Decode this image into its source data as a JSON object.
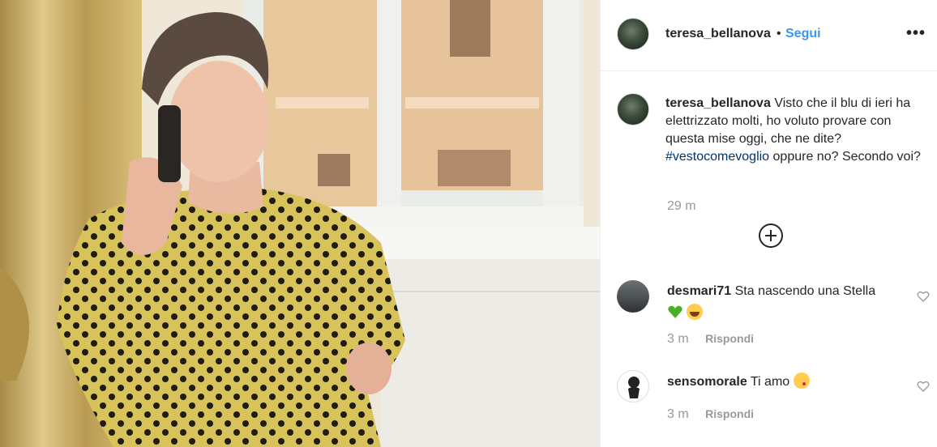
{
  "post": {
    "username": "teresa_bellanova",
    "separator": "•",
    "follow_label": "Segui",
    "more_label": "•••"
  },
  "caption": {
    "username": "teresa_bellanova",
    "text_before": "Visto che il blu di ieri ha elettrizzato molti, ho voluto provare con questa mise oggi, che ne dite?",
    "hashtag": "#vestocomevoglio",
    "text_after": "oppure no? Secondo voi?",
    "time": "29 m"
  },
  "comments": [
    {
      "username": "desmari71",
      "text": "Sta nascendo una Stella",
      "emojis": [
        "green-heart",
        "laughing-face"
      ],
      "time": "3 m",
      "reply_label": "Rispondi"
    },
    {
      "username": "sensomorale",
      "text": "Ti amo",
      "emojis": [
        "kissing-face"
      ],
      "time": "3 m",
      "reply_label": "Rispondi"
    }
  ],
  "colors": {
    "accent": "#3897f0",
    "hashtag": "#003569",
    "muted": "#999999"
  }
}
